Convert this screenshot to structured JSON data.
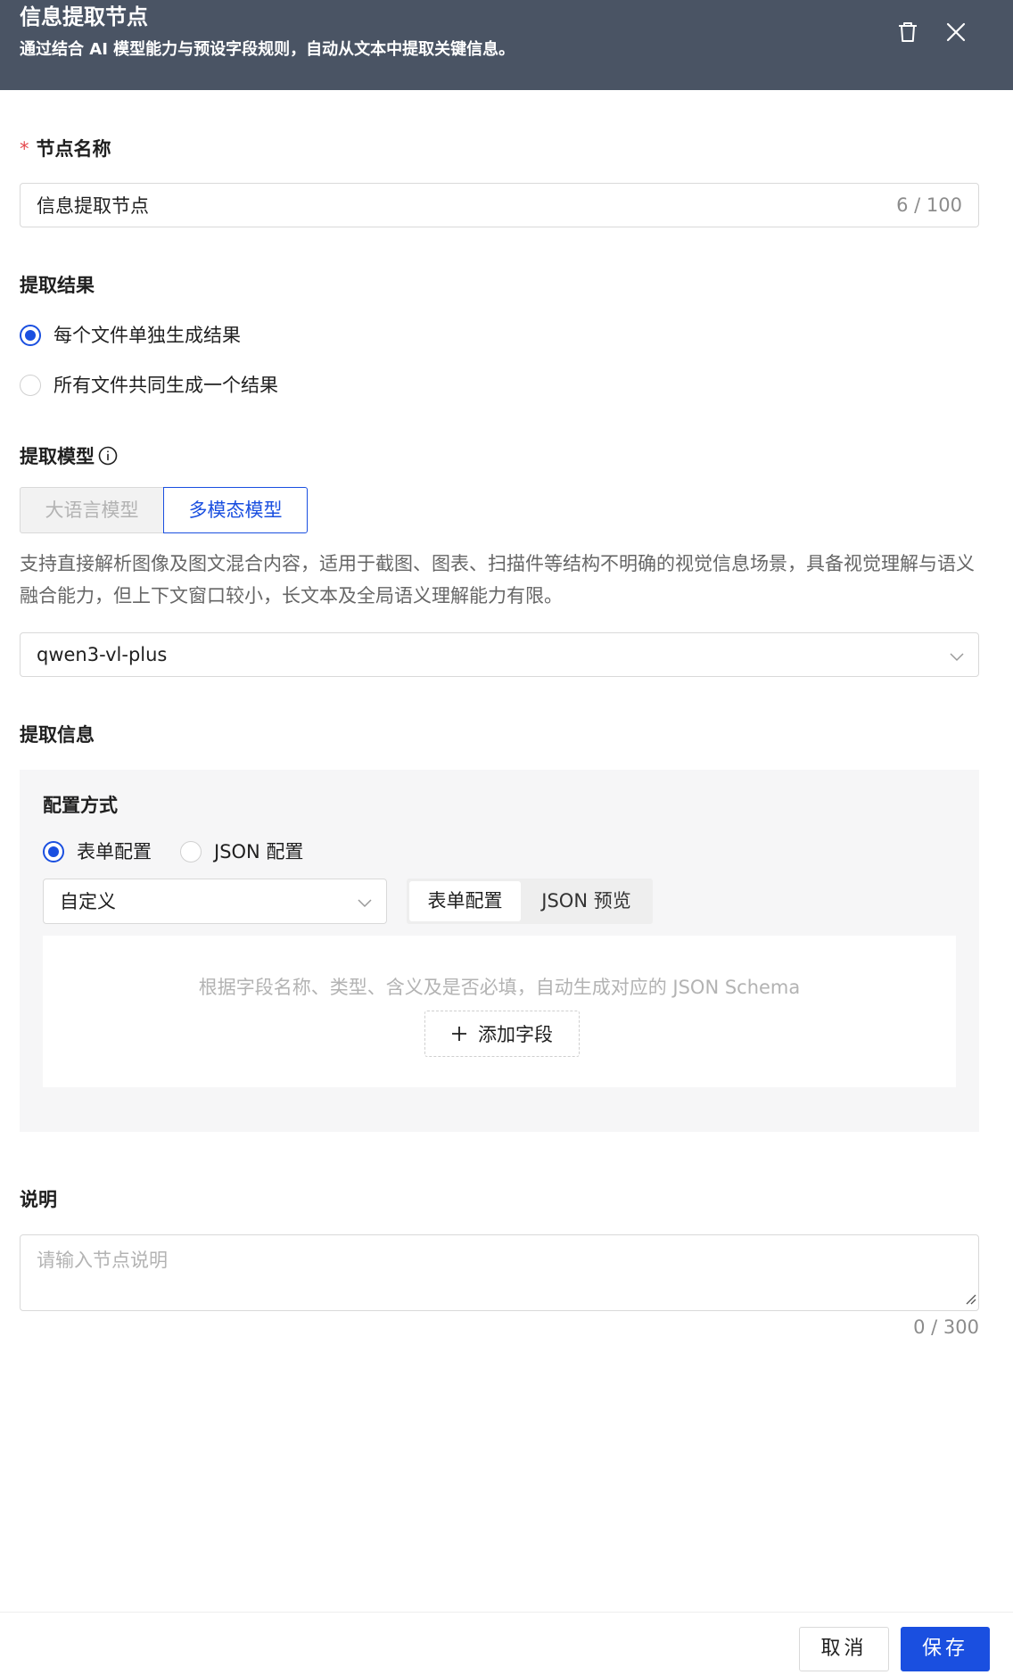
{
  "header": {
    "title": "信息提取节点",
    "subtitle": "通过结合 AI 模型能力与预设字段规则，自动从文本中提取关键信息。",
    "delete_icon": "trash-icon",
    "close_icon": "close-icon"
  },
  "node_name": {
    "label": "节点名称",
    "required_mark": "*",
    "value": "信息提取节点",
    "count": "6 / 100"
  },
  "extract_result": {
    "label": "提取结果",
    "options": [
      {
        "label": "每个文件单独生成结果",
        "checked": true
      },
      {
        "label": "所有文件共同生成一个结果",
        "checked": false
      }
    ]
  },
  "extract_model": {
    "label": "提取模型",
    "tabs": [
      {
        "label": "大语言模型",
        "active": false
      },
      {
        "label": "多模态模型",
        "active": true
      }
    ],
    "description": "支持直接解析图像及图文混合内容，适用于截图、图表、扫描件等结构不明确的视觉信息场景，具备视觉理解与语义融合能力，但上下文窗口较小，长文本及全局语义理解能力有限。",
    "selected_model": "qwen3-vl-plus"
  },
  "extract_info": {
    "label": "提取信息",
    "config_label": "配置方式",
    "config_options": [
      {
        "label": "表单配置",
        "checked": true
      },
      {
        "label": "JSON 配置",
        "checked": false
      }
    ],
    "schema_select": "自定义",
    "view_toggle": [
      {
        "label": "表单配置",
        "active": true
      },
      {
        "label": "JSON 预览",
        "active": false
      }
    ],
    "hint": "根据字段名称、类型、含义及是否必填，自动生成对应的 JSON Schema",
    "add_field_label": "添加字段"
  },
  "description": {
    "label": "说明",
    "placeholder": "请输入节点说明",
    "value": "",
    "count": "0 / 300"
  },
  "footer": {
    "cancel_label": "取消",
    "save_label": "保存"
  },
  "colors": {
    "header_bg": "#4a5464",
    "accent": "#1a4fe0",
    "required": "#e5484d",
    "panel_bg": "#f6f6f7"
  }
}
